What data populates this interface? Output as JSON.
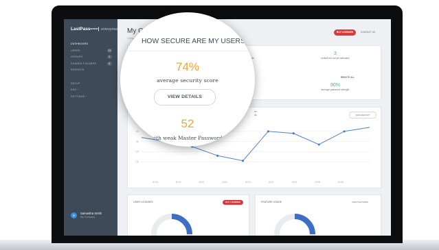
{
  "app": {
    "logo_text": "LastPass",
    "logo_dots": "••••|",
    "logo_suffix": "enterprise"
  },
  "sidebar": {
    "items": [
      {
        "label": "DASHBOARD",
        "active": true
      },
      {
        "label": "USERS",
        "count": "23"
      },
      {
        "label": "GROUPS",
        "count": "4"
      },
      {
        "label": "SHARED FOLDERS",
        "count": "5"
      },
      {
        "label": "REPORTS"
      }
    ],
    "items2": [
      {
        "label": "SETUP"
      },
      {
        "label": "SSO ›"
      },
      {
        "label": "SETTINGS ›"
      }
    ],
    "user": {
      "name": "Samantha Smith",
      "company": "My Company",
      "initial": "S"
    }
  },
  "header": {
    "title": "My C",
    "subtitle": "Comp",
    "buy_button": "BUY LICENSES",
    "contact_link": "CONTACT US"
  },
  "stats": {
    "invited_value": "3",
    "invited_label": "invited but not yet activated",
    "remote_label": "REMOTE ALL",
    "pw_value": "90%",
    "pw_label": "average password strength",
    "partial_left_1": "ords",
    "partial_left_2": "ore"
  },
  "chart_card": {
    "view_report": "VIEW REPORT",
    "partial_text_1": "es",
    "partial_text_2": "ds"
  },
  "licenses_card": {
    "label": "USER LICENSES",
    "button": "BUY LICENSES"
  },
  "features_card": {
    "label": "FEATURE USAGE",
    "link": "VIEW FEATURES"
  },
  "magnifier": {
    "title": "HOW SECURE ARE MY USERS?",
    "score": "74%",
    "score_label": "average security score",
    "button": "VIEW DETAILS",
    "weak_count": "52",
    "weak_label": "with weak Master Passwords"
  },
  "colors": {
    "accent_red": "#d93b3b",
    "score_orange": "#f2a531",
    "stat_green": "#3cbf77",
    "line_blue": "#4a7fd1",
    "sidebar_bg": "#3d4a57"
  },
  "chart_data": {
    "type": "line",
    "x": [
      "8/18",
      "8/19",
      "8/20",
      "8/21",
      "8/22",
      "8/23",
      "8/24",
      "8/25",
      "8/26"
    ],
    "y_ticks": [
      "40",
      "30",
      "20",
      "10"
    ],
    "ylim": [
      0,
      50
    ],
    "series": [
      {
        "values": [
          34,
          30,
          25,
          16,
          11,
          40,
          38,
          27,
          40,
          44
        ]
      }
    ],
    "grid": true
  }
}
